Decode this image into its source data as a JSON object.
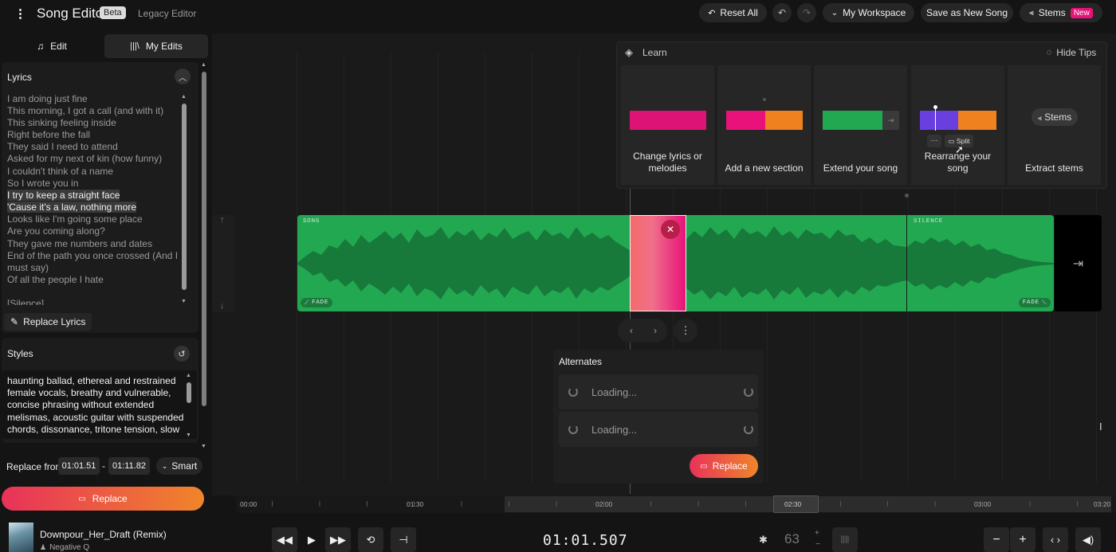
{
  "header": {
    "title": "Song Editor",
    "beta_badge": "Beta",
    "legacy_link": "Legacy Editor",
    "reset_all": "Reset All",
    "workspace": "My Workspace",
    "save_new": "Save as New Song",
    "stems": "Stems",
    "new_badge": "New"
  },
  "left_tabs": {
    "edit": "Edit",
    "my_edits": "My Edits"
  },
  "lyrics": {
    "heading": "Lyrics",
    "lines": [
      "I am doing just fine",
      "This morning, I got a call (and with it)",
      "This sinking feeling inside",
      "Right before the fall",
      "They said I need to attend",
      "Asked for my next of kin (how funny)",
      "I couldn't think of a name",
      "So I wrote you in",
      "I try to keep a straight face",
      "'Cause it's a law, nothing more",
      "Looks like I'm going some place",
      "Are you coming along?",
      "They gave me numbers and dates",
      "End of the path you once crossed (And I",
      "must say)",
      "Of all the people I hate",
      "",
      "[Silence]"
    ],
    "replace_label": "Replace Lyrics"
  },
  "styles": {
    "heading": "Styles",
    "text": "haunting ballad, ethereal and restrained female vocals, breathy and vulnerable, concise phrasing without extended melismas, acoustic guitar with suspended chords, dissonance, tritone tension, slow"
  },
  "replace_from": {
    "label": "Replace from",
    "start": "01:01.51",
    "dash": "-",
    "end": "01:11.82",
    "mode": "Smart"
  },
  "replace_button": "Replace",
  "tips": {
    "heading": "Learn",
    "hide": "Hide Tips",
    "cards": [
      {
        "label": "Change lyrics or melodies"
      },
      {
        "label": "Add a new section"
      },
      {
        "label": "Extend your song"
      },
      {
        "label": "Rearrange your song",
        "split": "Split"
      },
      {
        "label": "Extract stems",
        "chip": "Stems"
      }
    ]
  },
  "timeline": {
    "tags": {
      "song": "SONG",
      "silence": "SILENCE",
      "fade": "FADE"
    },
    "ticks": [
      "00:00",
      "01:30",
      "02:00",
      "02:30",
      "03:00",
      "03:20"
    ]
  },
  "alternates": {
    "heading": "Alternates",
    "rows": [
      "Loading...",
      "Loading..."
    ],
    "replace": "Replace"
  },
  "player": {
    "track": "Downpour_Her_Draft (Remix)",
    "artist": "Negative Q",
    "time": "01:01.507",
    "bpm": "63"
  },
  "colors": {
    "green": "#22a851",
    "pink": "#e8127a",
    "orange": "#f0811f",
    "purple": "#6a3fe0",
    "replace_gradient_start": "#e8325a",
    "replace_gradient_end": "#f0852a"
  }
}
